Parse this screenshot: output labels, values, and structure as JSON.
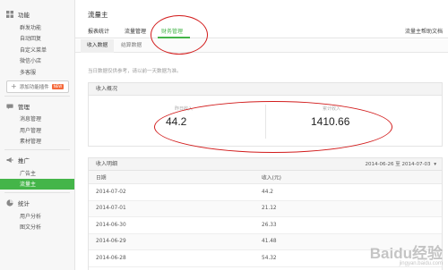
{
  "sidebar": {
    "groups": [
      {
        "title": "功能",
        "icon": "grid-icon",
        "items": [
          "群发功能",
          "自动回复",
          "自定义菜单",
          "微信小店",
          "多客服"
        ]
      },
      {
        "title": "管理",
        "icon": "chat-icon",
        "items": [
          "消息管理",
          "用户管理",
          "素材管理"
        ]
      },
      {
        "title": "推广",
        "icon": "megaphone-icon",
        "items": [
          "广告主",
          "流量主"
        ]
      },
      {
        "title": "统计",
        "icon": "chart-icon",
        "items": [
          "用户分析",
          "图文分析"
        ]
      }
    ],
    "add_plugin_label": "添加功能插件",
    "add_plugin_badge": "NEW",
    "active_item": "流量主"
  },
  "header": {
    "title": "流量主",
    "tabs": [
      "报表统计",
      "流量管理",
      "财务管理"
    ],
    "active_tab": "财务管理",
    "help_link": "流量主帮助文档"
  },
  "sub_tabs": [
    "收入数据",
    "结算数据"
  ],
  "active_sub_tab": "收入数据",
  "notice": "当日数据仅供参考，请以前一天数据为准。",
  "overview": {
    "title": "收入概况",
    "yesterday_label": "昨日收入",
    "yesterday_value": "44.2",
    "total_label": "累计收入",
    "total_value": "1410.66"
  },
  "detail": {
    "title": "收入明细",
    "date_range": "2014-06-26 至 2014-07-03",
    "columns": [
      "日期",
      "收入(元)"
    ],
    "rows": [
      [
        "2014-07-02",
        "44.2"
      ],
      [
        "2014-07-01",
        "21.12"
      ],
      [
        "2014-06-30",
        "26.33"
      ],
      [
        "2014-06-29",
        "41.48"
      ],
      [
        "2014-06-28",
        "54.32"
      ]
    ]
  },
  "colors": {
    "accent": "#44b549",
    "annotation": "#d21c1c"
  },
  "watermark": {
    "main": "Baidu经验",
    "sub": "jingyan.baidu.com"
  }
}
